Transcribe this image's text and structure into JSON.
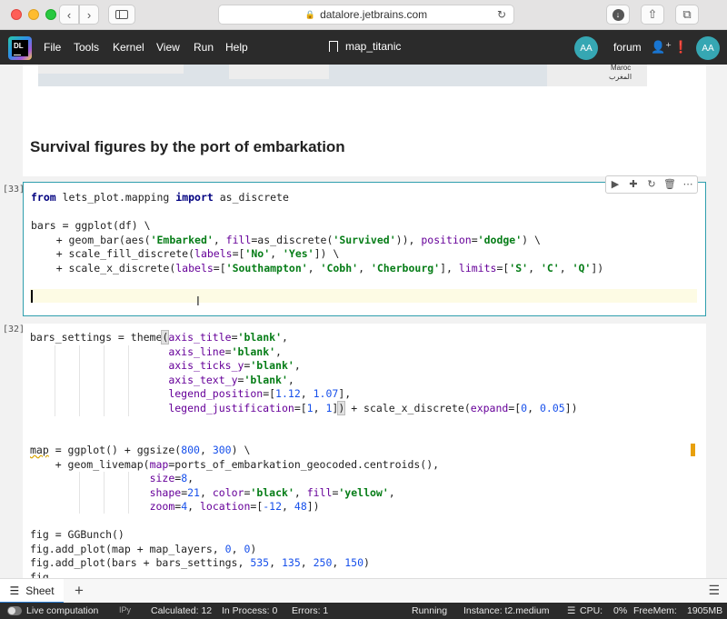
{
  "browser": {
    "url": "datalore.jetbrains.com"
  },
  "menubar": {
    "logo_text_top": "DL",
    "items": [
      "File",
      "Tools",
      "Kernel",
      "View",
      "Run",
      "Help"
    ],
    "notebook_title": "map_titanic",
    "user_initials": "AA",
    "forum_label": "forum"
  },
  "map_preview": {
    "label": "Maroc",
    "sublabel": "المغرب"
  },
  "markdown_cell": {
    "heading": "Survival figures by the port of embarkation"
  },
  "cell33": {
    "exec_count": "[33]",
    "toolbar_icons": [
      "run-icon",
      "add-cell-icon",
      "rerun-icon",
      "delete-icon",
      "more-icon"
    ]
  },
  "cell32": {
    "exec_count": "[32]"
  },
  "sheet_bar": {
    "tab_label": "Sheet",
    "add_label": "+"
  },
  "status_bar": {
    "live_computation": "Live computation",
    "kernel": "IPy",
    "calculated": "Calculated: 12",
    "in_process": "In Process: 0",
    "errors": "Errors: 1",
    "state": "Running",
    "instance": "Instance: t2.medium",
    "cpu": "CPU:",
    "cpu_value": "0%",
    "freemem": "FreeMem:",
    "freemem_value": "1905MB"
  },
  "colors": {
    "accent": "#2f9fae",
    "keyword": "#000080",
    "string": "#067d17",
    "number": "#1750eb"
  }
}
